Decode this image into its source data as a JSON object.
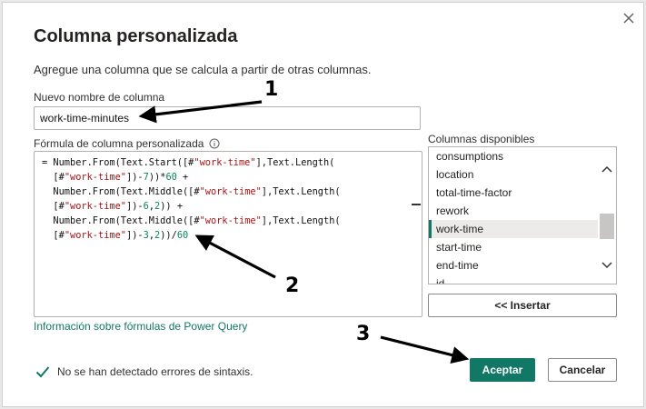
{
  "dialog": {
    "title": "Columna personalizada",
    "description": "Agregue una columna que se calcula a partir de otras columnas.",
    "close_icon": "close-icon"
  },
  "name_field": {
    "label": "Nuevo nombre de columna",
    "value": "work-time-minutes"
  },
  "formula": {
    "label": "Fórmula de columna personalizada",
    "info_icon": "info-icon",
    "lines": [
      "= Number.From(Text.Start([#\"work-time\"],Text.Length(",
      "  [#\"work-time\"])-7))*60 +",
      "  Number.From(Text.Middle([#\"work-time\"],Text.Length(",
      "  [#\"work-time\"])-6,2)) +",
      "  Number.From(Text.Middle([#\"work-time\"],Text.Length(",
      "  [#\"work-time\"])-3,2))/60"
    ]
  },
  "columns": {
    "label": "Columnas disponibles",
    "items": [
      "consumptions",
      "location",
      "total-time-factor",
      "rework",
      "work-time",
      "start-time",
      "end-time",
      "id"
    ],
    "selected": "work-time",
    "insert_label": "<< Insertar"
  },
  "help_link": "Información sobre fórmulas de Power Query",
  "status": {
    "text": "No se han detectado errores de sintaxis.",
    "icon": "check-icon"
  },
  "buttons": {
    "ok": "Aceptar",
    "cancel": "Cancelar"
  },
  "annotations": [
    "1",
    "2",
    "3"
  ],
  "colors": {
    "accent": "#117865",
    "number_literal": "#098658",
    "string_literal": "#a31515"
  }
}
